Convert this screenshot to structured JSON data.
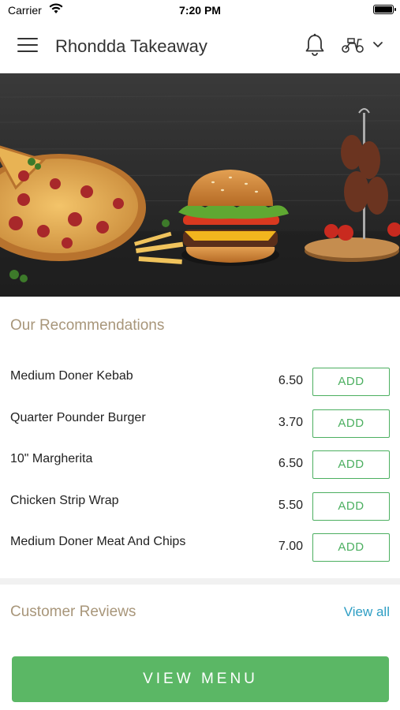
{
  "status_bar": {
    "carrier": "Carrier",
    "time": "7:20 PM"
  },
  "header": {
    "title": "Rhondda Takeaway",
    "icons": [
      "hamburger-menu-icon",
      "bell-icon",
      "scooter-icon",
      "chevron-down-icon"
    ]
  },
  "recommendations": {
    "title": "Our Recommendations",
    "items": [
      {
        "name": "Medium Doner Kebab",
        "price": "6.50",
        "add_label": "ADD"
      },
      {
        "name": "Quarter Pounder Burger",
        "price": "3.70",
        "add_label": "ADD"
      },
      {
        "name": "10\" Margherita",
        "price": "6.50",
        "add_label": "ADD"
      },
      {
        "name": "Chicken Strip Wrap",
        "price": "5.50",
        "add_label": "ADD"
      },
      {
        "name": "Medium Doner Meat And Chips",
        "price": "7.00",
        "add_label": "ADD"
      }
    ]
  },
  "reviews": {
    "title": "Customer Reviews",
    "view_all_label": "View all"
  },
  "footer": {
    "view_menu_label": "VIEW MENU"
  },
  "colors": {
    "accent_green": "#5bb765",
    "section_title": "#a8967a",
    "link_blue": "#2e9ec4"
  }
}
